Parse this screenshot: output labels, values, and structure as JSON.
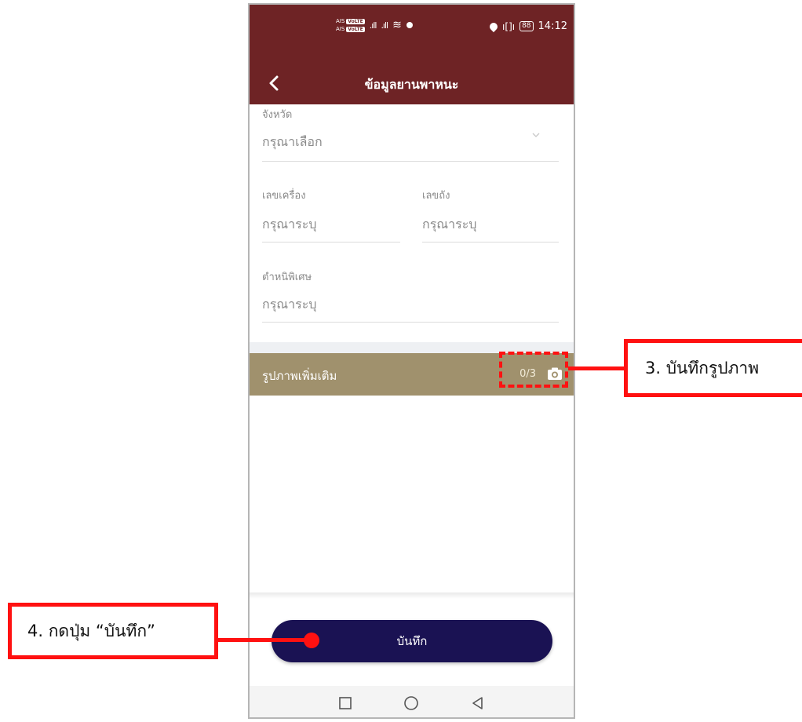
{
  "status_bar": {
    "sim1_label": "AIS",
    "sim2_label": "AIS",
    "volte": "VoLTE",
    "signal1": ".ıll",
    "signal2": ".ıll",
    "wifi": "≋",
    "vibrate": "ı[]ı",
    "battery": "88",
    "time": "14:12"
  },
  "header": {
    "title": "ข้อมูลยานพาหนะ"
  },
  "form": {
    "province": {
      "label": "จังหวัด",
      "placeholder": "กรุณาเลือก"
    },
    "engine_no": {
      "label": "เลขเครื่อง",
      "placeholder": "กรุณาระบุ"
    },
    "chassis_no": {
      "label": "เลขถัง",
      "placeholder": "กรุณาระบุ"
    },
    "special_mark": {
      "label": "ตำหนิพิเศษ",
      "placeholder": "กรุณาระบุ"
    }
  },
  "photos": {
    "label": "รูปภาพเพิ่มเติม",
    "count": "0/3"
  },
  "save_button": {
    "label": "บันทึก"
  },
  "annotations": {
    "step3": "3. บันทึกรูปภาพ",
    "step4": "4. กดปุ่ม “บันทึก”"
  },
  "colors": {
    "header_bg": "#6e2325",
    "photo_bar_bg": "#a0916d",
    "button_bg": "#1a1253",
    "annotation_red": "#ff1111"
  },
  "icons": [
    "back-arrow-icon",
    "chevron-down-icon",
    "camera-icon",
    "location-icon",
    "nav-recents-icon",
    "nav-home-icon",
    "nav-back-icon"
  ]
}
